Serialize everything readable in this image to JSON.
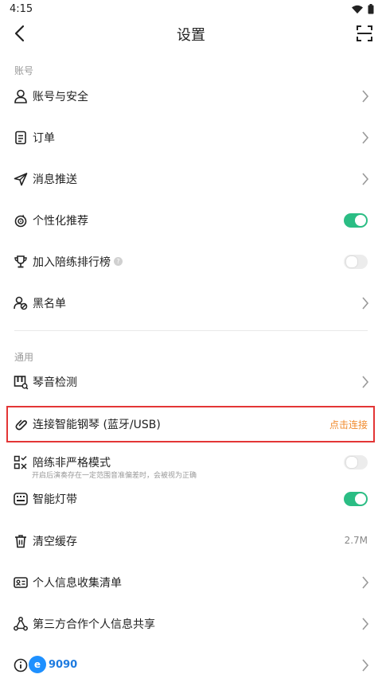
{
  "status_bar": {
    "time": "4:15"
  },
  "header": {
    "title": "设置"
  },
  "sections": {
    "account": "账号",
    "general": "通用"
  },
  "rows": {
    "account_security": {
      "label": "账号与安全"
    },
    "orders": {
      "label": "订单"
    },
    "push": {
      "label": "消息推送"
    },
    "personalized": {
      "label": "个性化推荐",
      "enabled": true
    },
    "ranking": {
      "label": "加入陪练排行榜",
      "enabled": false
    },
    "blacklist": {
      "label": "黑名单"
    },
    "tuner": {
      "label": "琴音检测"
    },
    "connect_piano": {
      "label": "连接智能钢琴 (蓝牙/USB)",
      "action": "点击连接"
    },
    "loose_mode": {
      "label": "陪练非严格模式",
      "sub": "开启后演奏存在一定范围音准偏差时，会被视为正确",
      "enabled": false
    },
    "light_strip": {
      "label": "智能灯带",
      "enabled": true
    },
    "clear_cache": {
      "label": "清空缓存",
      "value": "2.7M"
    },
    "personal_info": {
      "label": "个人信息收集清单"
    },
    "third_party": {
      "label": "第三方合作个人信息共享"
    }
  },
  "watermark": {
    "logo": "e",
    "text": "9090"
  },
  "colors": {
    "accent": "#2bbd84",
    "action": "#f08a2c",
    "highlight": "#e33535"
  }
}
